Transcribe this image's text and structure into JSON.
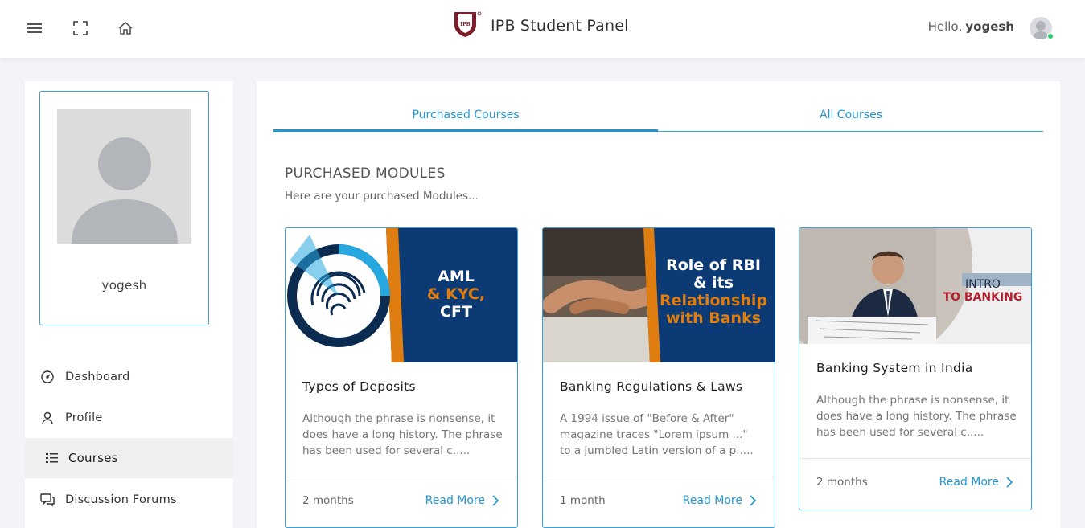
{
  "header": {
    "title": "IPB Student Panel",
    "greeting": "Hello,",
    "username": "yogesh",
    "logo_text": "IPB",
    "icons": [
      "menu-icon",
      "fullscreen-icon",
      "home-icon"
    ]
  },
  "sidebar": {
    "profile_name": "yogesh",
    "items": [
      {
        "label": "Dashboard",
        "icon": "dashboard-icon"
      },
      {
        "label": "Profile",
        "icon": "user-icon"
      },
      {
        "label": "Courses",
        "icon": "list-icon",
        "active": true
      },
      {
        "label": "Discussion Forums",
        "icon": "chat-icon"
      }
    ]
  },
  "main": {
    "tabs": [
      {
        "label": "Purchased Courses",
        "active": true
      },
      {
        "label": "All Courses",
        "active": false
      }
    ],
    "section_title": "PURCHASED MODULES",
    "section_subtitle": "Here are your purchased Modules...",
    "cards": [
      {
        "title": "Types of Deposits",
        "description": "Although the phrase is nonsense, it does have a long history. The phrase has been used for several c.....",
        "duration": "2 months",
        "read_more": "Read More",
        "thumb_lines": [
          "AML",
          "& KYC,",
          "CFT"
        ]
      },
      {
        "title": "Banking Regulations & Laws",
        "description": "A 1994 issue of \"Before & After\" magazine traces \"Lorem ipsum ...\" to a jumbled Latin version of a p.....",
        "duration": "1 month",
        "read_more": "Read More",
        "thumb_lines": [
          "Role of RBI",
          "& its",
          "Relationship",
          "with Banks"
        ]
      },
      {
        "title": "Banking System in India",
        "description": "Although the phrase is nonsense, it does have a long history. The phrase has been used for several c.....",
        "duration": "2 months",
        "read_more": "Read More",
        "thumb_lines": [
          "INTRO",
          "TO BANKING"
        ]
      }
    ]
  },
  "colors": {
    "accent": "#2196d3",
    "navy": "#0c3a74",
    "orange": "#e07d10",
    "maroon": "#7a1f2b",
    "online": "#2ecc71"
  }
}
